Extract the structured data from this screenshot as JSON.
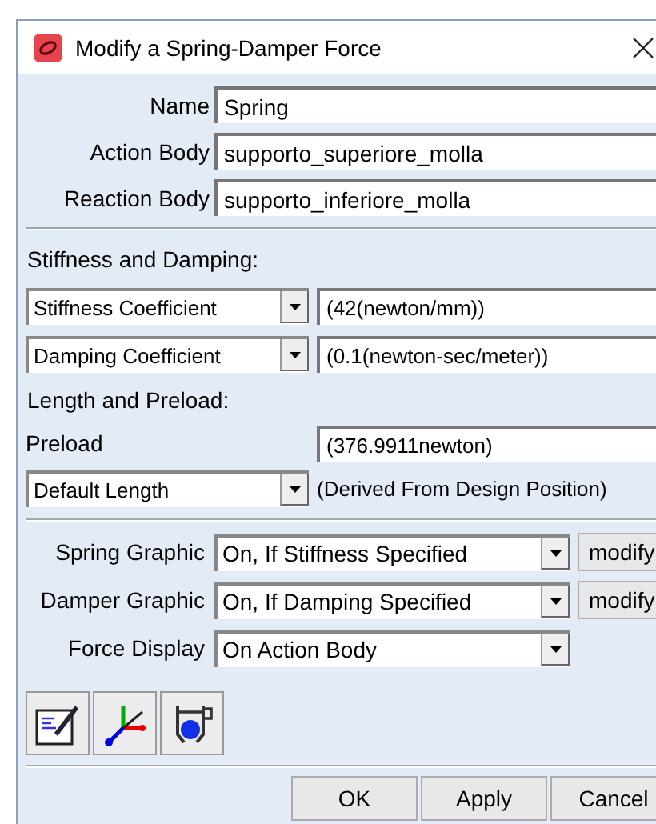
{
  "window": {
    "title": "Modify a Spring-Damper Force"
  },
  "fields": [
    {
      "label": "Name",
      "value": "Spring"
    },
    {
      "label": "Action Body",
      "value": "supporto_superiore_molla"
    },
    {
      "label": "Reaction Body",
      "value": "supporto_inferiore_molla"
    }
  ],
  "stiffness_section": {
    "heading": "Stiffness and Damping:",
    "rows": [
      {
        "option": "Stiffness Coefficient",
        "value": "(42(newton/mm))"
      },
      {
        "option": "Damping Coefficient",
        "value": "(0.1(newton-sec/meter))"
      }
    ]
  },
  "length_section": {
    "heading": "Length and Preload:",
    "preload_label": "Preload",
    "preload_value": "(376.9911newton)",
    "length_option": "Default Length",
    "length_note": "(Derived From Design Position)"
  },
  "graphics": [
    {
      "label": "Spring Graphic",
      "option": "On, If Stiffness Specified",
      "modify": "modify"
    },
    {
      "label": "Damper Graphic",
      "option": "On, If Damping Specified",
      "modify": "modify"
    },
    {
      "label": "Force Display",
      "option": "On Action Body"
    }
  ],
  "buttons": [
    "OK",
    "Apply",
    "Cancel"
  ]
}
